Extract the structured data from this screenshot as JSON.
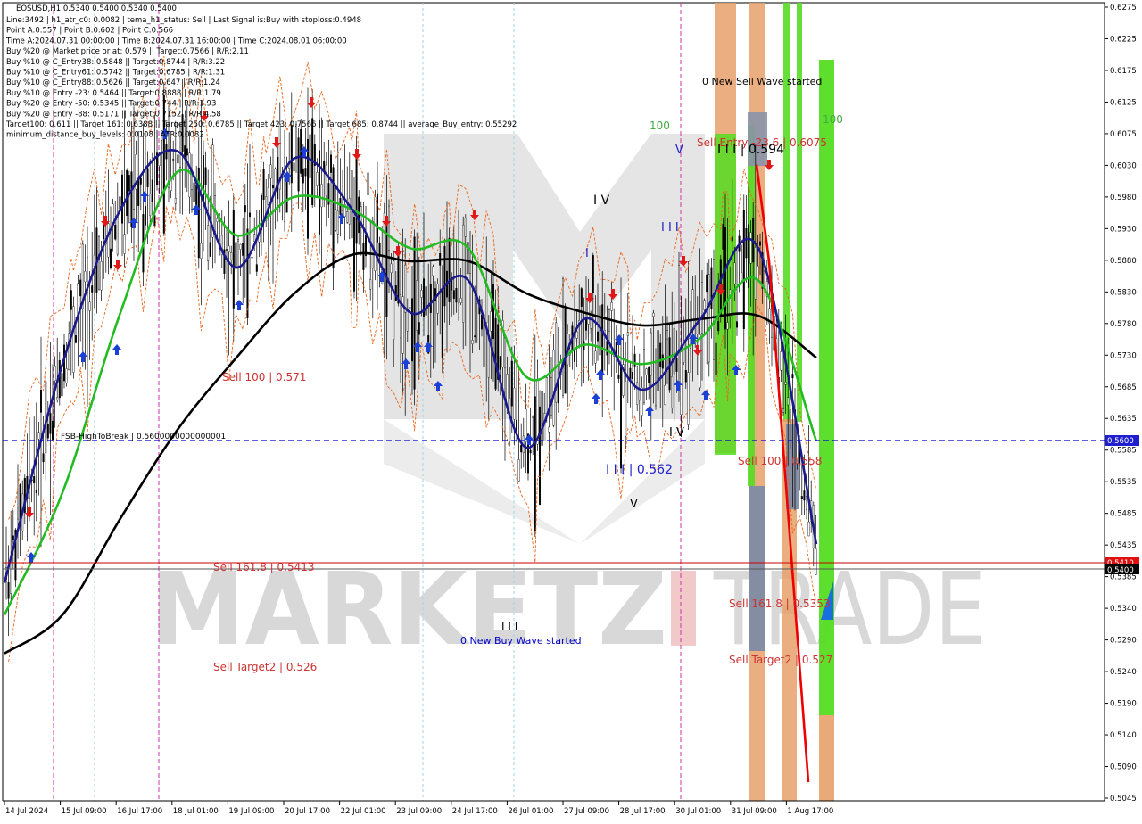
{
  "header": {
    "symbol_line": "EOSUSD,H1  0.5340 0.5400 0.5340 0.5400",
    "info_lines": [
      "Line:3492 | h1_atr_c0: 0.0082 | tema_h1_status: Sell | Last Signal is:Buy with stoploss:0.4948",
      "Point A:0.557 | Point B:0.602 | Point C:0.566",
      "Time A:2024.07.31 00:00:00 | Time B:2024.07.31 16:00:00 | Time C:2024.08.01 06:00:00",
      "Buy %20 @ Market price or at: 0.579 || Target:0.7566 | R/R:2.11",
      "Buy %10 @ C_Entry38: 0.5848 || Target:0.8744 | R/R:3.22",
      "Buy %10 @ C_Entry61: 0.5742 || Target:0.6785 | R/R:1.31",
      "Buy %10 @ C_Entry88: 0.5626 || Target:0.647 | R/R:1.24",
      "Buy %10 @ Entry -23: 0.5464 || Target:0.8888 | R/R:1.79",
      "Buy %20 @ Entry -50: 0.5345 || Target:0.744 | R/R:1.93",
      "Buy %20 @ Entry -88: 0.5171 || Target:0.7152 | R/R:4.58",
      "Target100: 0.611 || Target 161: 0.6388 || Target 250: 0.6785 || Target 423: 0.7566 || Target 685: 0.8744 || average_Buy_entry: 0.55292",
      "minimum_distance_buy_levels: 0.0108 | ATR:0.0082"
    ]
  },
  "watermark": {
    "left": "MARKETZ",
    "right": "TRADE"
  },
  "price_scale": {
    "ticks": [
      "0.6275",
      "0.6225",
      "0.6175",
      "0.6125",
      "0.6075",
      "0.6030",
      "0.5980",
      "0.5930",
      "0.5880",
      "0.5830",
      "0.5780",
      "0.5730",
      "0.5685",
      "0.5635",
      "0.5585",
      "0.5535",
      "0.5485",
      "0.5435",
      "0.5385",
      "0.5340",
      "0.5290",
      "0.5240",
      "0.5190",
      "0.5140",
      "0.5090",
      "0.5045"
    ],
    "badge_blue": "0.5600",
    "badge_red": "0.5410",
    "badge_black": "0.5400"
  },
  "time_scale": {
    "labels": [
      "14 Jul 2024",
      "15 Jul 09:00",
      "16 Jul 17:00",
      "18 Jul 01:00",
      "19 Jul 09:00",
      "20 Jul 17:00",
      "22 Jul 01:00",
      "23 Jul 09:00",
      "24 Jul 17:00",
      "26 Jul 01:00",
      "27 Jul 09:00",
      "28 Jul 17:00",
      "30 Jul 01:00",
      "31 Jul 09:00",
      "1 Aug 17:00"
    ]
  },
  "annotations": {
    "fsb": "FSB-HighToBreak | 0.5600000000000001",
    "sell100_left": "Sell 100 | 0.571",
    "sell161_left": "Sell 161.8 | 0.5413",
    "sell_target2_left": "Sell Target2 | 0.526",
    "new_buy_wave": "0 New Buy Wave started",
    "wave_iii_low": "I I I",
    "wave_iii_562": "I I I | 0.562",
    "wave_v_low": "V",
    "wave_iv": "I V",
    "wave_i": "I",
    "wave_iii_mid": "I I I",
    "wave_v_top": "V",
    "wave_iv_right": "I V",
    "label_100_left": "100",
    "label_100_right": "100",
    "sell_entry": "Sell Entry -23.6 | 0.6075",
    "iii_0594": "I I I | 0.594",
    "new_sell_wave": "0 New Sell Wave started",
    "sell100_right": "Sell 100 | 0.558",
    "sell161_right": "Sell 161.8 | 0.5353",
    "sell_target2_right": "Sell Target2 | 0.527"
  },
  "colors": {
    "blue_line": "#0000cc",
    "red_line": "#cc0000",
    "ma_green": "#22bb22",
    "ma_black": "#000000",
    "tema_navy": "#1a1a8c",
    "bright_green": "#55dd22",
    "orange": "#e8a06a",
    "grey_blue": "#7a8aa6"
  },
  "chart_data": {
    "type": "candlestick",
    "symbol": "EOSUSD",
    "timeframe": "H1",
    "ohlc_last": {
      "open": 0.534,
      "high": 0.54,
      "low": 0.534,
      "close": 0.54
    },
    "ylim": [
      0.5045,
      0.6275
    ],
    "horizontal_levels": [
      {
        "label": "FSB-HighToBreak",
        "value": 0.56,
        "color": "#0000cc",
        "style": "dashed"
      },
      {
        "label": "Sell 161.8",
        "value": 0.5413,
        "color": "#cc0000",
        "style": "solid"
      },
      {
        "label": "last price",
        "value": 0.54,
        "color": "#000000",
        "style": "solid"
      }
    ],
    "black_ma": [
      [
        "14 Jul",
        0.527
      ],
      [
        "15 Jul 09:00",
        0.533
      ],
      [
        "16 Jul 17:00",
        0.548
      ],
      [
        "18 Jul 01:00",
        0.562
      ],
      [
        "19 Jul 09:00",
        0.573
      ],
      [
        "20 Jul 17:00",
        0.583
      ],
      [
        "22 Jul 01:00",
        0.589
      ],
      [
        "23 Jul 09:00",
        0.588
      ],
      [
        "24 Jul 17:00",
        0.588
      ],
      [
        "26 Jul 01:00",
        0.583
      ],
      [
        "27 Jul 09:00",
        0.58
      ],
      [
        "28 Jul 17:00",
        0.578
      ],
      [
        "30 Jul 01:00",
        0.579
      ],
      [
        "31 Jul 09:00",
        0.5795
      ],
      [
        "1 Aug 01:00",
        0.573
      ]
    ],
    "green_ma": [
      [
        "14 Jul",
        0.533
      ],
      [
        "15 Jul 09:00",
        0.552
      ],
      [
        "16 Jul 17:00",
        0.58
      ],
      [
        "18 Jul 01:00",
        0.602
      ],
      [
        "19 Jul 09:00",
        0.592
      ],
      [
        "20 Jul 17:00",
        0.598
      ],
      [
        "22 Jul 01:00",
        0.596
      ],
      [
        "23 Jul 09:00",
        0.59
      ],
      [
        "24 Jul 17:00",
        0.59
      ],
      [
        "26 Jul 01:00",
        0.57
      ],
      [
        "27 Jul 09:00",
        0.575
      ],
      [
        "28 Jul 17:00",
        0.572
      ],
      [
        "30 Jul 01:00",
        0.576
      ],
      [
        "31 Jul 09:00",
        0.585
      ],
      [
        "1 Aug 01:00",
        0.56
      ]
    ],
    "tema_line": [
      [
        "14 Jul",
        0.538
      ],
      [
        "15 Jul 09:00",
        0.572
      ],
      [
        "16 Jul 17:00",
        0.596
      ],
      [
        "18 Jul 01:00",
        0.605
      ],
      [
        "19 Jul 09:00",
        0.587
      ],
      [
        "20 Jul 17:00",
        0.604
      ],
      [
        "22 Jul 01:00",
        0.596
      ],
      [
        "23 Jul 09:00",
        0.58
      ],
      [
        "24 Jul 17:00",
        0.585
      ],
      [
        "26 Jul 01:00",
        0.559
      ],
      [
        "27 Jul 09:00",
        0.579
      ],
      [
        "28 Jul 17:00",
        0.568
      ],
      [
        "30 Jul 01:00",
        0.579
      ],
      [
        "31 Jul 09:00",
        0.59
      ],
      [
        "1 Aug 01:00",
        0.544
      ]
    ],
    "red_projection": [
      [
        "31 Jul 09:00",
        0.603
      ],
      [
        "31 Jul 16:00",
        0.588
      ],
      [
        "1 Aug 02:00",
        0.507
      ]
    ]
  }
}
